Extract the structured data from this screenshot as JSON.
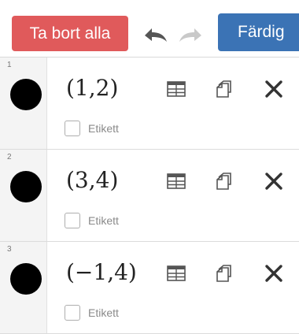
{
  "toolbar": {
    "clear_all_label": "Ta bort alla",
    "done_label": "Färdig",
    "undo_icon": "undo-icon",
    "redo_icon": "redo-icon"
  },
  "expressions": [
    {
      "index": "1",
      "expression": "(1,2)",
      "label_option": "Etikett",
      "color": "#000000"
    },
    {
      "index": "2",
      "expression": "(3,4)",
      "label_option": "Etikett",
      "color": "#000000"
    },
    {
      "index": "3",
      "expression": "(−1,4)",
      "label_option": "Etikett",
      "color": "#000000"
    }
  ],
  "colors": {
    "clear_button": "#e05a5b",
    "done_button": "#3b73b5",
    "point": "#000000"
  }
}
